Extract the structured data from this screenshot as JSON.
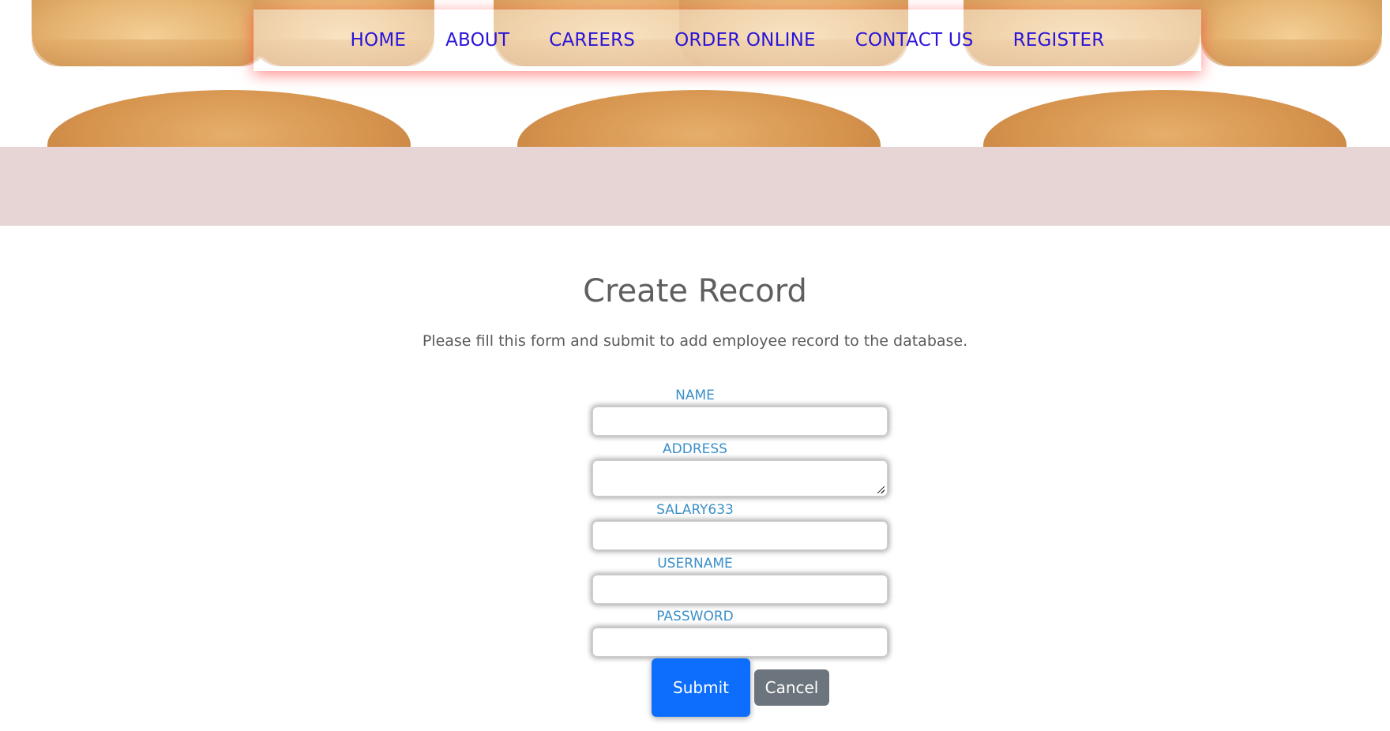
{
  "nav": {
    "items": [
      {
        "label": "HOME"
      },
      {
        "label": "ABOUT"
      },
      {
        "label": "CAREERS"
      },
      {
        "label": "ORDER ONLINE"
      },
      {
        "label": "CONTACT US"
      },
      {
        "label": "REGISTER"
      }
    ]
  },
  "form": {
    "title": "Create Record",
    "subtitle": "Please fill this form and submit to add employee record to the database.",
    "fields": [
      {
        "label": "NAME",
        "value": ""
      },
      {
        "label": "ADDRESS",
        "value": ""
      },
      {
        "label": "SALARY633",
        "value": ""
      },
      {
        "label": "USERNAME",
        "value": ""
      },
      {
        "label": "PASSWORD",
        "value": ""
      }
    ],
    "submit_label": "Submit",
    "cancel_label": "Cancel"
  },
  "colors": {
    "nav_link": "#2a14d8",
    "label": "#3a8fc9",
    "submit": "#0d6efd",
    "cancel": "#6c757d",
    "band": "#e7d5d6"
  }
}
